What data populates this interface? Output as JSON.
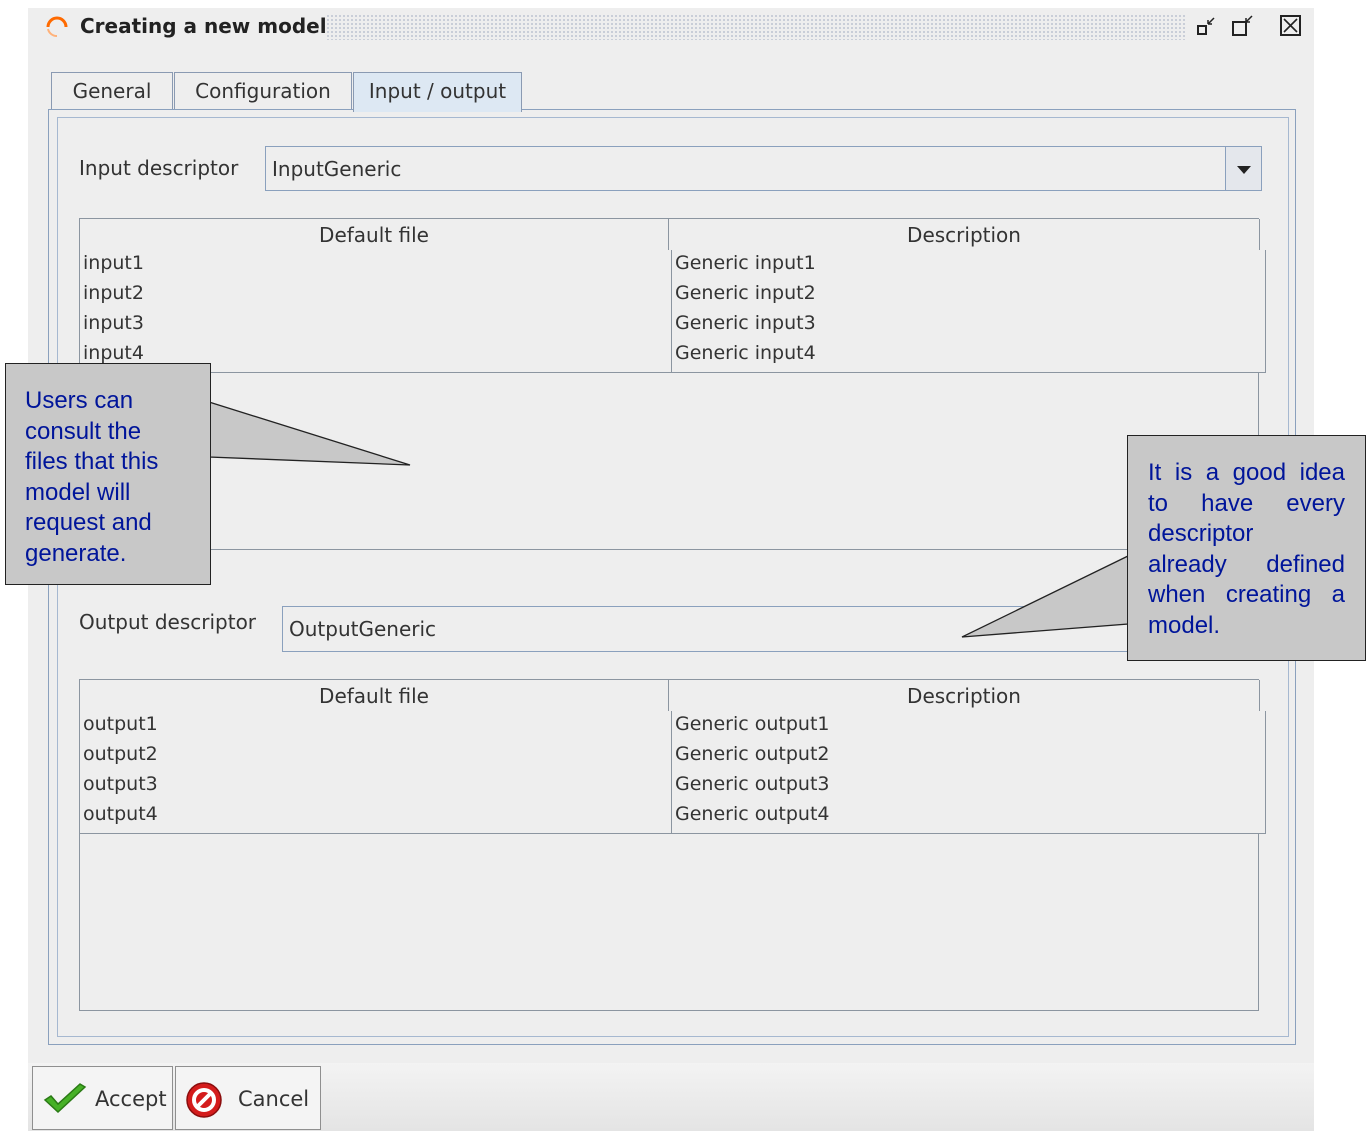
{
  "window": {
    "title": "Creating a new model",
    "controls": [
      "minimize-icon",
      "maximize-icon",
      "close-icon"
    ]
  },
  "tabs": [
    {
      "label": "General"
    },
    {
      "label": "Configuration"
    },
    {
      "label": "Input / output",
      "active": true
    }
  ],
  "input": {
    "label": "Input descriptor",
    "value": "InputGeneric",
    "columns": [
      "Default file",
      "Description"
    ],
    "rows": [
      [
        "input1",
        "Generic input1"
      ],
      [
        "input2",
        "Generic input2"
      ],
      [
        "input3",
        "Generic input3"
      ],
      [
        "input4",
        "Generic input4"
      ]
    ]
  },
  "output": {
    "label": "Output descriptor",
    "value": "OutputGeneric",
    "columns": [
      "Default file",
      "Description"
    ],
    "rows": [
      [
        "output1",
        "Generic output1"
      ],
      [
        "output2",
        "Generic output2"
      ],
      [
        "output3",
        "Generic output3"
      ],
      [
        "output4",
        "Generic output4"
      ]
    ]
  },
  "buttons": {
    "accept": "Accept",
    "cancel": "Cancel"
  },
  "callouts": {
    "left": [
      "Users can",
      "consult the",
      "files that this",
      "model will",
      "request and",
      "generate."
    ],
    "right": [
      "It is a good idea",
      "to have every",
      "descriptor",
      "already defined",
      "when creating a",
      "model."
    ]
  },
  "colors": {
    "callout_text": "#00159a",
    "callout_fill": "#c8c8c8",
    "active_tab": "#dde8f3",
    "border_blue": "#8aa0bd"
  }
}
